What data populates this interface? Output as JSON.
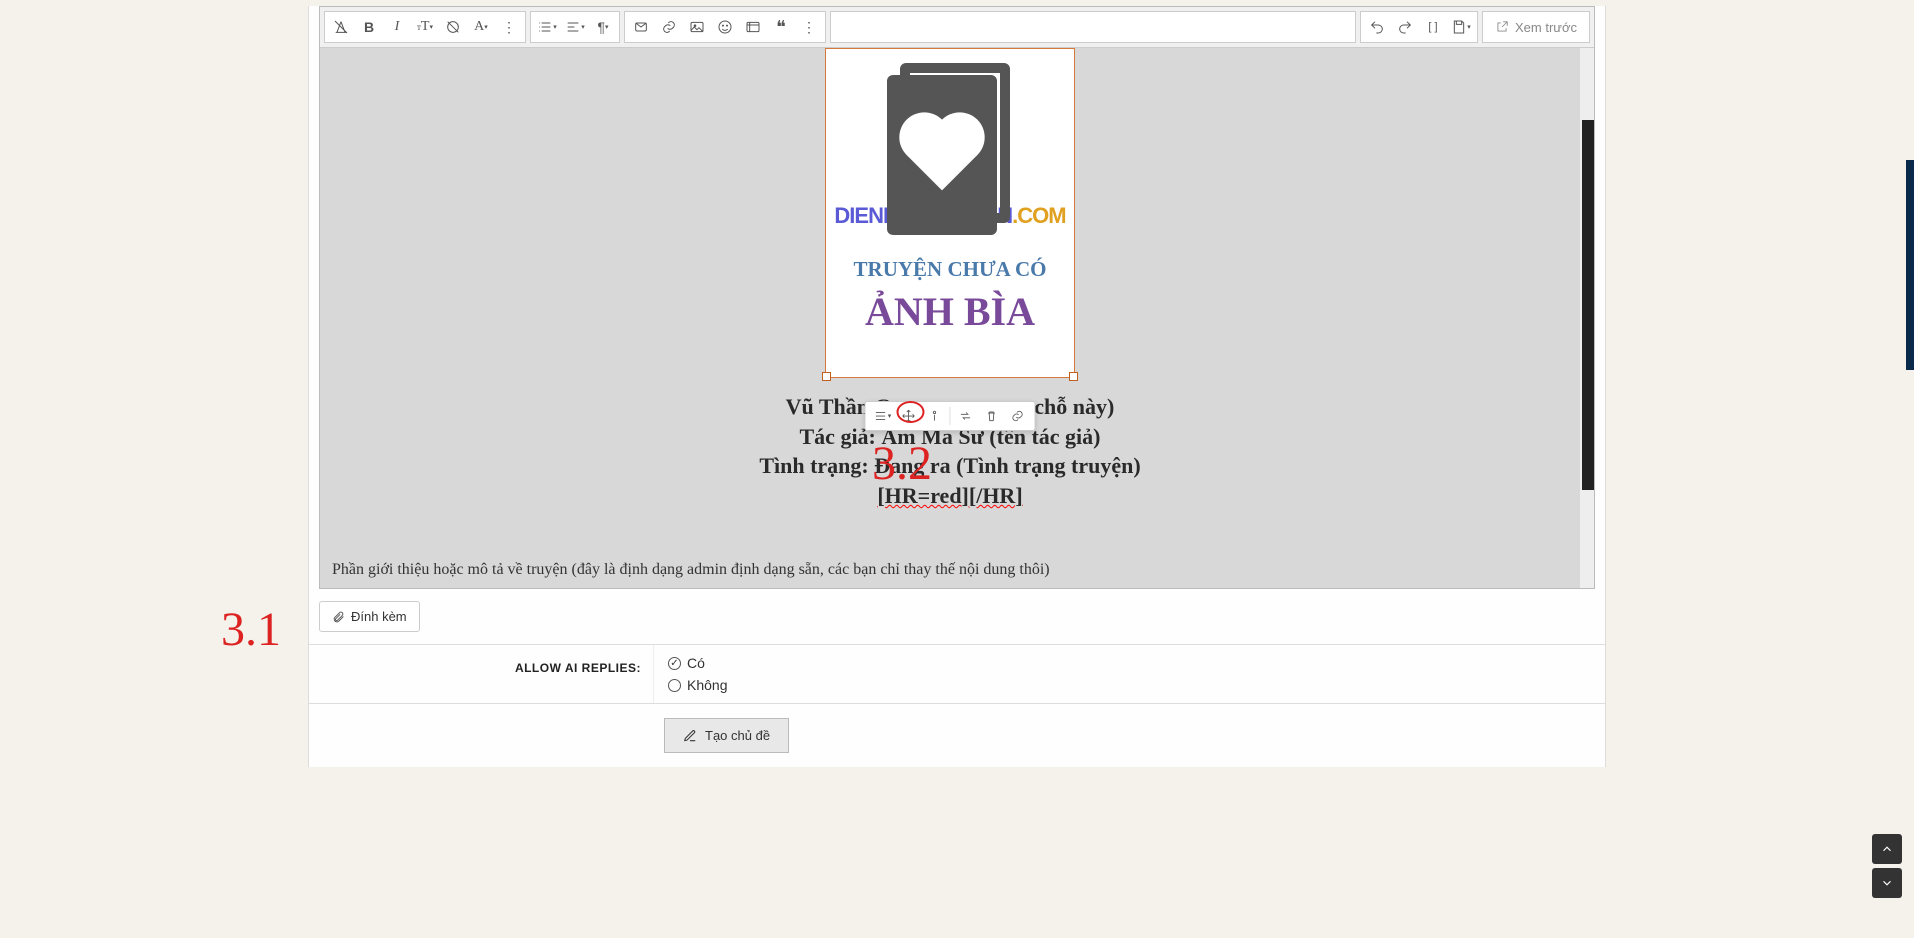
{
  "toolbar": {
    "preview_label": "Xem trước"
  },
  "cover": {
    "brand_a": "DIENDANTRUYEN",
    "brand_b": ".COM",
    "line1": "TRUYỆN CHƯA CÓ",
    "line2": "ẢNH BÌA"
  },
  "story": {
    "line1": "Vũ Thần Chúa Tể (Bỏ tên chỗ này)",
    "line1_visible_left": "Vũ Thần C",
    "line1_visible_right": "n chỗ này)",
    "line2": "Tác giả: Ám Ma Sư (tên tác giả)",
    "line3": "Tình trạng: Đang ra (Tình trạng truyện)",
    "line4": "[HR=red][/HR]"
  },
  "desc": "Phần giới thiệu hoặc mô tả về truyện (đây là định dạng admin định dạng sẵn, các bạn chỉ thay thế nội dung thôi)",
  "attach_label": "Đính kèm",
  "allow_ai": {
    "label": "Allow AI replies:",
    "yes": "Có",
    "no": "Không",
    "selected": "yes"
  },
  "submit_label": "Tạo chủ đề",
  "annotations": {
    "a31": "3.1",
    "a32": "3.2"
  }
}
